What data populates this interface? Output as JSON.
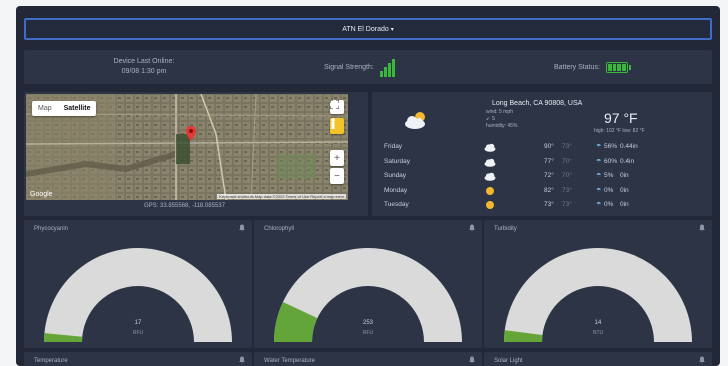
{
  "header": {
    "device_label": "ATN El Dorado",
    "dropdown_caret": "▾"
  },
  "status": {
    "last_online_label": "Device Last Online:",
    "last_online_value": "09/08 1:30 pm",
    "signal_label": "Signal Strength:",
    "signal_bars": 4,
    "battery_label": "Battery Status:",
    "battery_cells": 4
  },
  "map": {
    "map_button": "Map",
    "satellite_button": "Satellite",
    "zoom_in": "+",
    "zoom_out": "−",
    "google_text": "Google",
    "attribution": "Keyboard shortcuts  Map data ©2023  Terms of Use  Report a map error",
    "gps": "GPS: 33.855568, -118.085537"
  },
  "weather": {
    "location": "Long Beach, CA 90808, USA",
    "wind": "wind: 5 mph",
    "wind_dir": "S",
    "humidity": "humidity: 45%",
    "current_temp": "97 °F",
    "high_low": "high: 102 °F  low: 82 °F",
    "icon": "partly-cloudy-icon",
    "forecast": [
      {
        "day": "Friday",
        "icon": "cloud-icon",
        "hi": "90°",
        "lo": "73°",
        "rain": "56%",
        "amt": "0.44in"
      },
      {
        "day": "Saturday",
        "icon": "cloud-icon",
        "hi": "77°",
        "lo": "70°",
        "rain": "60%",
        "amt": "0.4in"
      },
      {
        "day": "Sunday",
        "icon": "cloud-icon",
        "hi": "72°",
        "lo": "70°",
        "rain": "5%",
        "amt": "0in"
      },
      {
        "day": "Monday",
        "icon": "sun-icon",
        "hi": "82°",
        "lo": "73°",
        "rain": "0%",
        "amt": "0in"
      },
      {
        "day": "Tuesday",
        "icon": "sun-icon",
        "hi": "73°",
        "lo": "73°",
        "rain": "0%",
        "amt": "0in"
      }
    ]
  },
  "gauges": [
    {
      "title": "Phycocyanin",
      "value": "17",
      "unit": "RFU",
      "fill_fraction": 0.03
    },
    {
      "title": "Chlorophyll",
      "value": "253",
      "unit": "RFU",
      "fill_fraction": 0.14
    },
    {
      "title": "Turbidity",
      "value": "14",
      "unit": "NTU",
      "fill_fraction": 0.04
    }
  ],
  "bottom_cards": [
    {
      "title": "Temperature"
    },
    {
      "title": "Water Temperature"
    },
    {
      "title": "Solar Light"
    }
  ],
  "colors": {
    "accent_green": "#3ab83a",
    "gauge_fill": "#64a53a",
    "gauge_track": "#dadada",
    "select_border": "#3f6cc6",
    "background": "#222838",
    "panel": "#2c3446"
  }
}
